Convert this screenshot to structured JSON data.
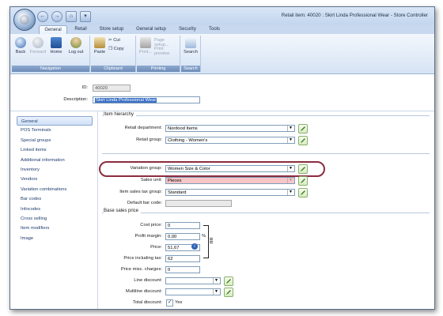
{
  "window": {
    "title": "Retail item: 40020 : Skirt Linda Professional Wear - Store Controller"
  },
  "tabs": [
    "General",
    "Retail",
    "Store setup",
    "General setup",
    "Security",
    "Tools"
  ],
  "ribbon": {
    "navigation": {
      "label": "Navigation",
      "back": "Back",
      "forward": "Forward",
      "home": "Home",
      "logout": "Log out"
    },
    "clipboard": {
      "label": "Clipboard",
      "paste": "Paste",
      "cut": "Cut",
      "copy": "Copy"
    },
    "printing": {
      "label": "Printing",
      "print": "Print...",
      "page_setup": "Page setup...",
      "print_preview": "Print preview"
    },
    "search": {
      "label": "Search",
      "search": "Search"
    }
  },
  "header": {
    "id_label": "ID:",
    "id_value": "40020",
    "description_label": "Description:",
    "description_value": "Skirt Linda Professional Wear"
  },
  "nav": {
    "active": "General",
    "items": [
      "General",
      "POS Terminals",
      "Special groups",
      "Linked items",
      "Additional information",
      "Inventory",
      "Vendors",
      "Variation combinations",
      "Bar codes",
      "Infocodes",
      "Cross selling",
      "Item modifiers",
      "Image"
    ]
  },
  "item_hierarchy": {
    "title": "Item hierarchy",
    "retail_department_label": "Retail department:",
    "retail_department_value": "Nonfood Items",
    "retail_group_label": "Retail group:",
    "retail_group_value": "Clothing - Women's",
    "variation_group_label": "Variation group:",
    "variation_group_value": "Women Size & Color",
    "sales_unit_label": "Sales unit:",
    "sales_unit_value": "Pieces",
    "tax_group_label": "Item sales tax group:",
    "tax_group_value": "Standard",
    "barcode_label": "Default bar code:",
    "barcode_value": ""
  },
  "base_sales_price": {
    "title": "Base sales price",
    "cost_price_label": "Cost price:",
    "cost_price_value": "0",
    "profit_margin_label": "Profit margin:",
    "profit_margin_value": "0,00",
    "percent": "%",
    "price_label": "Price:",
    "price_value": "51,67",
    "price_incl_tax_label": "Price including tax:",
    "price_incl_tax_value": "62",
    "misc_charges_label": "Price misc. charges:",
    "misc_charges_value": "0",
    "line_discount_label": "Line discount:",
    "line_discount_value": "",
    "multiline_discount_label": "Multiline discount:",
    "multiline_discount_value": "",
    "total_discount_label": "Total discount:",
    "total_discount_value": "Yes",
    "total_discount_checked": true
  },
  "colors": {
    "accent": "#3a6fc4",
    "ribbon_label": "#6d8cb8",
    "highlight_oval": "#8b2c3f",
    "edit_green": "#8ab06e"
  }
}
